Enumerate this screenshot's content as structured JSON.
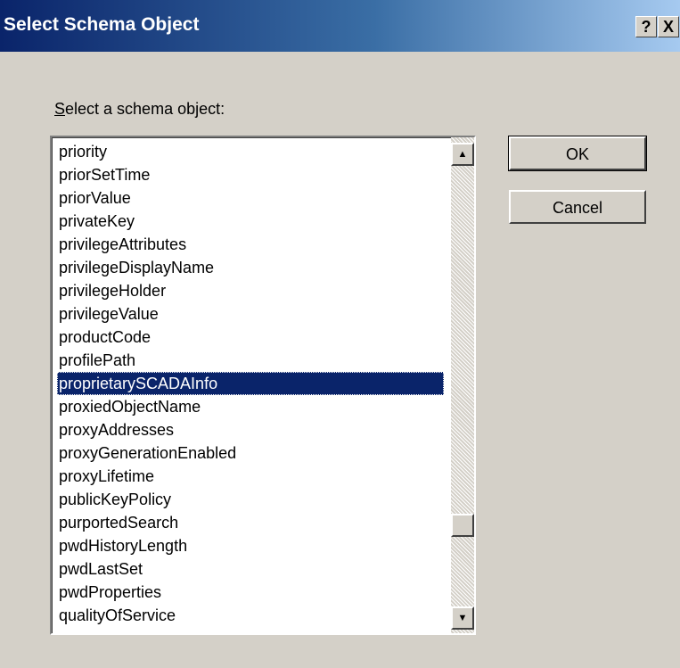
{
  "window": {
    "title": "Select Schema Object",
    "help_label": "?",
    "close_label": "X"
  },
  "label": {
    "prefix_ul": "S",
    "text": "elect a schema object:"
  },
  "list": {
    "items": [
      "priority",
      "priorSetTime",
      "priorValue",
      "privateKey",
      "privilegeAttributes",
      "privilegeDisplayName",
      "privilegeHolder",
      "privilegeValue",
      "productCode",
      "profilePath",
      "proprietarySCADAInfo",
      "proxiedObjectName",
      "proxyAddresses",
      "proxyGenerationEnabled",
      "proxyLifetime",
      "publicKeyPolicy",
      "purportedSearch",
      "pwdHistoryLength",
      "pwdLastSet",
      "pwdProperties",
      "qualityOfService"
    ],
    "selected": "proprietarySCADAInfo",
    "scroll_up_icon": "triangle-up",
    "scroll_down_icon": "triangle-down"
  },
  "buttons": {
    "ok": "OK",
    "cancel": "Cancel"
  }
}
